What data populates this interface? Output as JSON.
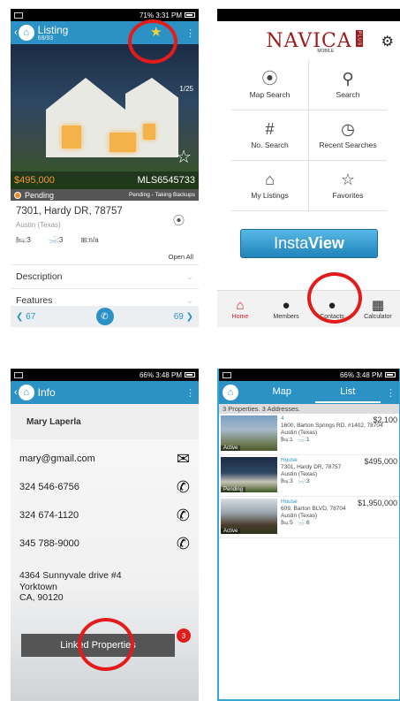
{
  "screen1": {
    "title": "Listing",
    "subtitle": "68/93",
    "photo_counter": "1/25",
    "price": "$495,000",
    "mls": "MLS6545733",
    "status": "Pending",
    "status_detail": "Pending - Taking Backups",
    "address": "7301, Hardy DR, 78757",
    "city": "Austin (Texas)",
    "beds": ":3",
    "baths": ":3",
    "area": ":n/a",
    "open_all": "Open All",
    "sections": [
      "Description",
      "Features"
    ],
    "prev_index": "67",
    "next_index": "69"
  },
  "screen2": {
    "logo": "NAVICA",
    "logo_sub": "MOBILE",
    "logo_plus": "PLUS",
    "menu": [
      {
        "label": "Map Search",
        "icon": "⦿"
      },
      {
        "label": "Search",
        "icon": "⚲"
      },
      {
        "label": "No. Search",
        "icon": "#"
      },
      {
        "label": "Recent Searches",
        "icon": "◷"
      },
      {
        "label": "My Listings",
        "icon": "⌂"
      },
      {
        "label": "Favorites",
        "icon": "☆"
      }
    ],
    "insta_a": "Insta",
    "insta_b": "View",
    "tabs": [
      {
        "label": "Home",
        "icon": "⌂"
      },
      {
        "label": "Members",
        "icon": "●"
      },
      {
        "label": "Contacts",
        "icon": "●"
      },
      {
        "label": "Calculator",
        "icon": "▦"
      }
    ]
  },
  "screen3": {
    "title": "Info",
    "name": "Mary Laperla",
    "email": "mary@gmail.com",
    "phones": [
      "324 546-6756",
      "324 674-1120",
      "345 788-9000"
    ],
    "address_lines": [
      "4364 Sunnyvale drive #4",
      "Yorktown",
      "CA, 90120"
    ],
    "linked_label": "Linked Properties",
    "linked_count": "3"
  },
  "screen4": {
    "tab_map": "Map",
    "tab_list": "List",
    "summary": "3 Properties. 3 Addresses.",
    "properties": [
      {
        "type": "4",
        "address": "1600, Barton Springs RD, #1402, 78704",
        "city": "Austin (Texas)",
        "beds": ":1",
        "baths": ":1",
        "price": "$2,100",
        "status": "Active"
      },
      {
        "type": "House",
        "address": "7301, Hardy DR, 78757",
        "city": "Austin (Texas)",
        "beds": ":3",
        "baths": ":3",
        "price": "$495,000",
        "status": "Pending"
      },
      {
        "type": "House",
        "address": "609, Barton BLVD, 78704",
        "city": "Austin (Texas)",
        "beds": ":5",
        "baths": ":6",
        "price": "$1,950,000",
        "status": "Active"
      }
    ]
  },
  "status_bars": {
    "s1": "71% 3:31 PM",
    "s3": "66% 3:48 PM",
    "s4": "66% 3:48 PM"
  }
}
